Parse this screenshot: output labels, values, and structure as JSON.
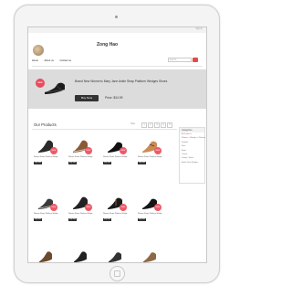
{
  "header": {
    "top_link": "Sign In",
    "store_name": "Zong Hao",
    "nav": [
      "Home",
      "About us",
      "Contact us"
    ],
    "search_placeholder": "Search"
  },
  "featured": {
    "badge": "NEW",
    "title": "Brand New Women's Mary Jane Ankle Strap Platform Wedges Shoes",
    "button": "Buy Now",
    "price": "Price: $34.99"
  },
  "products_section": {
    "title": "Our Products",
    "sort_label": "View",
    "pages": [
      "1",
      "2",
      "3",
      "4",
      "5"
    ],
    "items": [
      {
        "text": "Women Shoes Platform Wedge",
        "badge": "NEW",
        "button": "Buy Now"
      },
      {
        "text": "Women Shoes Platform Wedge",
        "badge": "NEW",
        "button": "Buy Now"
      },
      {
        "text": "Women Shoes Platform Wedge",
        "badge": "NEW",
        "button": "Buy Now"
      },
      {
        "text": "Women Shoes Platform Wedge",
        "badge": "NEW",
        "button": "Buy Now"
      },
      {
        "text": "Women Shoes Platform Wedge",
        "badge": "NEW",
        "button": "Buy Now"
      },
      {
        "text": "Women Shoes Platform Wedge",
        "badge": "NEW",
        "button": "Buy Now"
      },
      {
        "text": "Women Shoes Platform Wedge",
        "badge": "NEW",
        "button": "Buy Now"
      },
      {
        "text": "Women Shoes Platform Wedge",
        "badge": "NEW",
        "button": "Buy Now"
      }
    ]
  },
  "sidebar": {
    "heading": "Categories",
    "items": [
      "All Products",
      "Women > Wedges > Platform",
      "Sandals",
      "Flats",
      "Boots",
      "Casual",
      "Pumps / Heels",
      "Ankle Strap Wedges"
    ]
  },
  "colors": {
    "accent": "#e94b5e",
    "dark_button": "#333333",
    "feature_background": "#dcdcdc"
  }
}
